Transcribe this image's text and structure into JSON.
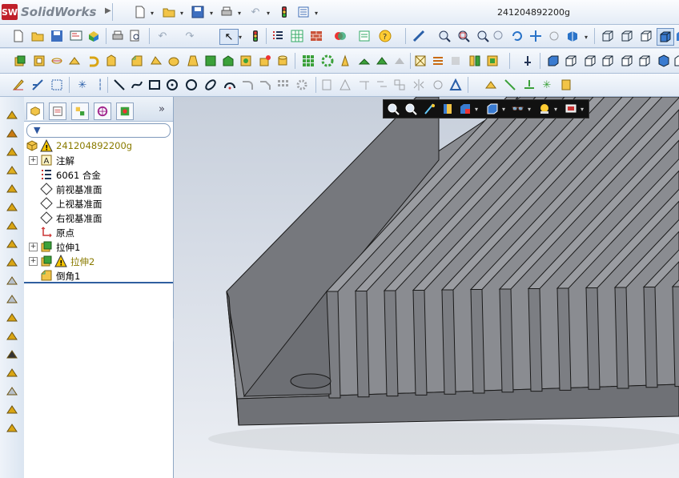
{
  "app": {
    "name": "SolidWorks",
    "logo_letters": "SW",
    "document_title": "241204892200g"
  },
  "feature_tree": {
    "filter_icon": "filter-icon",
    "items": [
      {
        "label": "241204892200g",
        "icon": "part-icon",
        "warning": true
      },
      {
        "label": "注解",
        "icon": "annotations-icon",
        "expandable": true
      },
      {
        "label": "6061 合金",
        "icon": "material-icon"
      },
      {
        "label": "前视基准面",
        "icon": "plane-icon"
      },
      {
        "label": "上视基准面",
        "icon": "plane-icon"
      },
      {
        "label": "右视基准面",
        "icon": "plane-icon"
      },
      {
        "label": "原点",
        "icon": "origin-icon"
      },
      {
        "label": "拉伸1",
        "icon": "extrude-icon",
        "expandable": true
      },
      {
        "label": "拉伸2",
        "icon": "extrude-icon",
        "expandable": true,
        "warning": true
      },
      {
        "label": "倒角1",
        "icon": "chamfer-icon"
      }
    ]
  },
  "colors": {
    "accent": "#2f5f9f",
    "model_face": "#7f8186",
    "model_edge": "#1a1a1a",
    "warning": "#f5c400"
  }
}
